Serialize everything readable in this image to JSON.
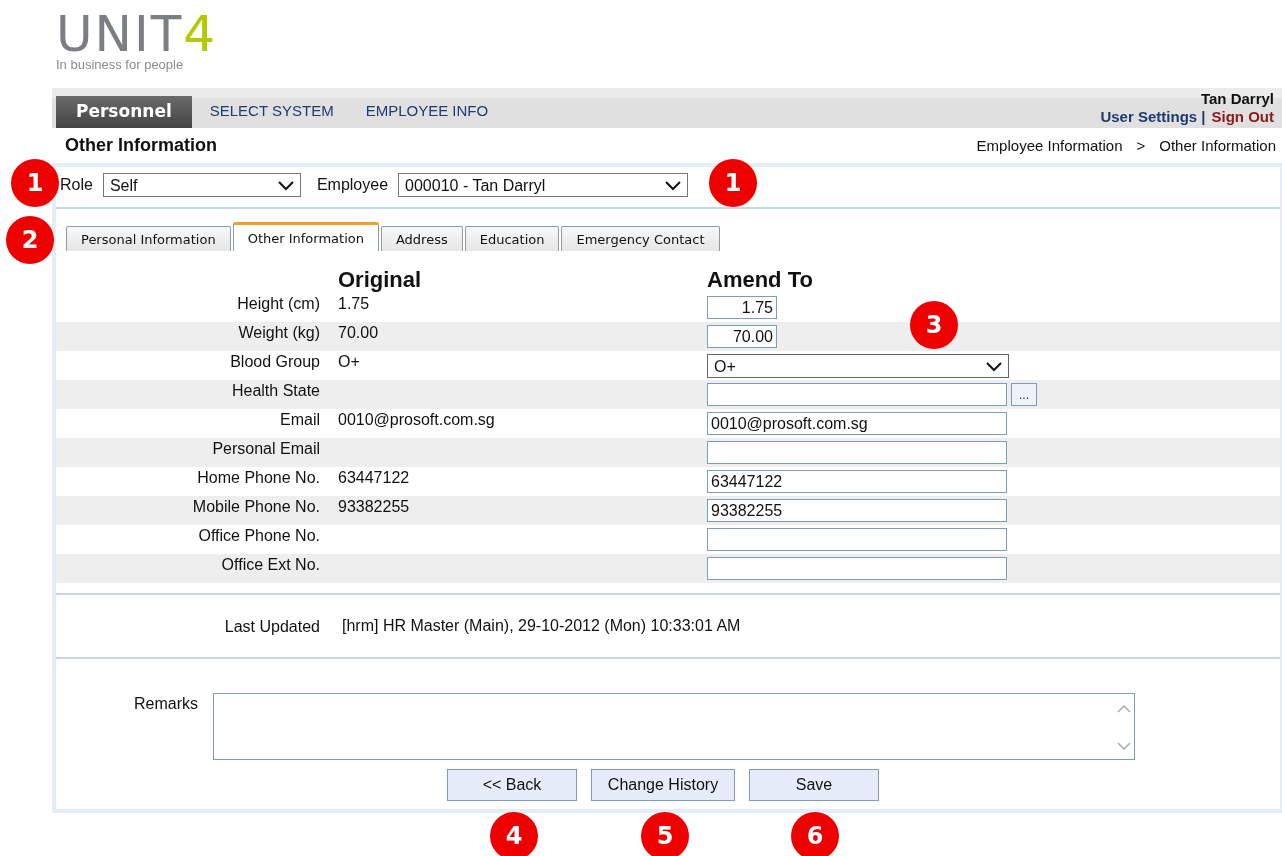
{
  "logo": {
    "wordmark": "UNIT",
    "digit": "4",
    "tagline": "In business for people"
  },
  "nav": {
    "items": [
      {
        "label": "Personnel",
        "selected": true
      },
      {
        "label": "SELECT SYSTEM",
        "selected": false
      },
      {
        "label": "EMPLOYEE INFO",
        "selected": false
      }
    ],
    "user": {
      "name": "Tan Darryl",
      "settings": "User Settings |",
      "sign_out": "Sign Out"
    }
  },
  "page_title": "Other Information",
  "breadcrumb": [
    "Employee Information",
    ">",
    "Other Information"
  ],
  "filters": [
    {
      "label": "Role",
      "value": "Self"
    },
    {
      "label": "Employee",
      "value": "000010 - Tan Darryl"
    }
  ],
  "tabs": [
    {
      "label": "Personal Information",
      "selected": false
    },
    {
      "label": "Other Information",
      "selected": true
    },
    {
      "label": "Address",
      "selected": false
    },
    {
      "label": "Education",
      "selected": false
    },
    {
      "label": "Emergency Contact",
      "selected": false
    }
  ],
  "table": {
    "columns": [
      "Original",
      "Amend To"
    ],
    "rows": [
      {
        "label": "Height (cm)",
        "original": "1.75",
        "amend": "1.75",
        "kind": "number"
      },
      {
        "label": "Weight (kg)",
        "original": "70.00",
        "amend": "70.00",
        "kind": "number"
      },
      {
        "label": "Blood Group",
        "original": "O+",
        "amend": "O+",
        "kind": "select"
      },
      {
        "label": "Health State",
        "kind": "lookup",
        "button": "..."
      },
      {
        "label": "Email",
        "original": "0010@prosoft.com.sg",
        "amend": "0010@prosoft.com.sg",
        "kind": "text"
      },
      {
        "label": "Personal Email",
        "kind": "text"
      },
      {
        "label": "Home Phone No.",
        "original": "63447122",
        "amend": "63447122",
        "kind": "text"
      },
      {
        "label": "Mobile Phone No.",
        "original": "93382255",
        "amend": "93382255",
        "kind": "text"
      },
      {
        "label": "Office Phone No.",
        "kind": "text"
      },
      {
        "label": "Office Ext No.",
        "kind": "text"
      }
    ]
  },
  "last_updated": {
    "label": "Last Updated",
    "value": "[hrm] HR Master (Main), 29-10-2012 (Mon) 10:33:01 AM"
  },
  "remarks": {
    "label": "Remarks"
  },
  "buttons": [
    "<< Back",
    "Change History",
    "Save"
  ],
  "callouts": [
    "1",
    "1",
    "2",
    "3",
    "4",
    "5",
    "6"
  ]
}
